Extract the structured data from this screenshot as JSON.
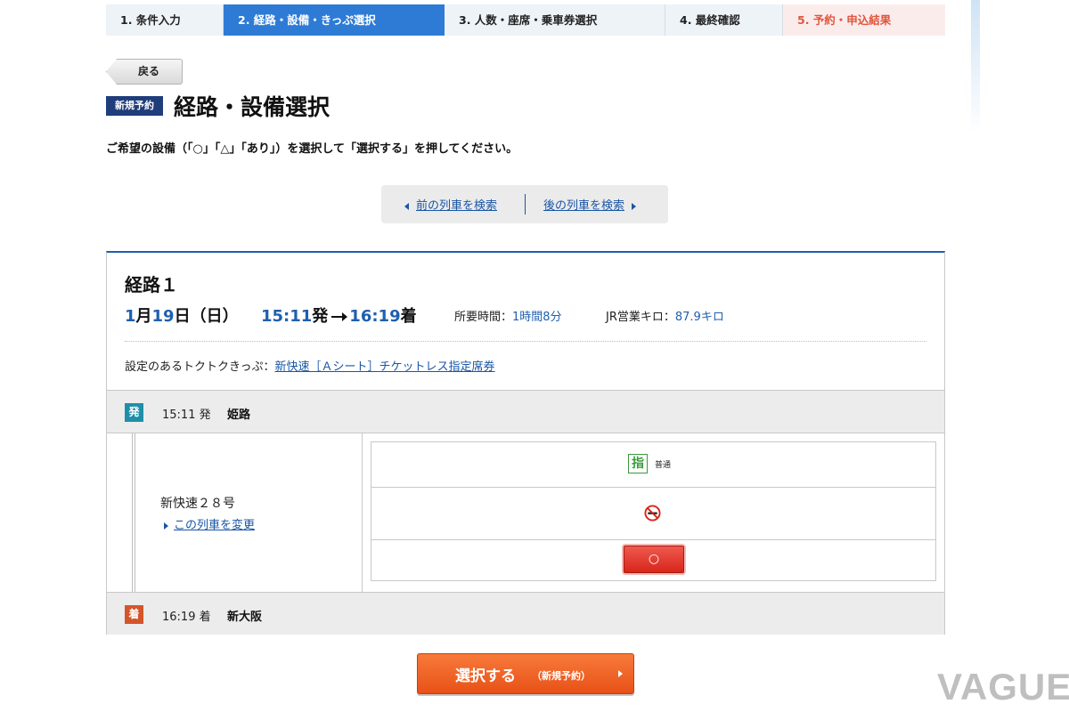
{
  "steps": [
    {
      "label": "1. 条件入力"
    },
    {
      "label": "2. 経路・設備・きっぷ選択"
    },
    {
      "label": "3. 人数・座席・乗車券選択"
    },
    {
      "label": "4. 最終確認"
    },
    {
      "label": "5. 予約・申込結果"
    }
  ],
  "back_button": "戻る",
  "badge_new": "新規予約",
  "page_title": "経路・設備選択",
  "instruction": "ご希望の設備（「○」「△」「あり」）を選択して「選択する」を押してください。",
  "nav": {
    "prev": "前の列車を検索",
    "next": "後の列車を検索"
  },
  "route": {
    "title": "経路１",
    "date_month": "1",
    "date_month_suffix": "月",
    "date_day": "19",
    "date_day_suffix": "日（日）",
    "dep_time": "15:11",
    "dep_suffix": "発",
    "arr_time": "16:19",
    "arr_suffix": "着",
    "duration_label": "所要時間：",
    "duration_value": "1時間8分",
    "distance_label": "JR営業キロ：",
    "distance_value": "87.9キロ",
    "ticket_label": "設定のあるトクトクきっぷ：",
    "ticket_link": "新快速［Ａシート］チケットレス指定席券"
  },
  "departure": {
    "badge": "発",
    "time": "15:11 発",
    "station": "姫路"
  },
  "arrival": {
    "badge": "着",
    "time": "16:19 着",
    "station": "新大阪"
  },
  "train": {
    "name": "新快速２８号",
    "change_link": "この列車を変更"
  },
  "seat": {
    "type_icon": "指",
    "type_label": "普通",
    "smoking_icon": "no-smoking-icon",
    "availability": "○"
  },
  "select_button": {
    "main": "選択する",
    "sub": "（新規予約）"
  },
  "watermark": "VAGUE",
  "colors": {
    "accent_blue": "#2e7bd6",
    "link_blue": "#1a56a6",
    "select_orange": "#e85117",
    "availability_red": "#d8251a"
  }
}
